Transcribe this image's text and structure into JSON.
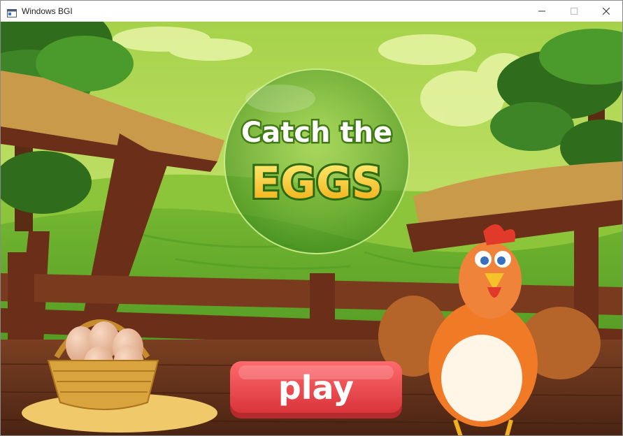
{
  "window": {
    "title": "Windows BGI",
    "minimize_glyph": "—",
    "maximize_glyph": "☐",
    "close_glyph": "✕"
  },
  "game": {
    "title_line1": "Catch the",
    "title_line2": "EGGS",
    "play_label": "play"
  },
  "colors": {
    "sky": "#c9e46a",
    "grass": "#5fa22a",
    "play_button": "#e9474b",
    "title_yellow": "#f6d21c"
  }
}
